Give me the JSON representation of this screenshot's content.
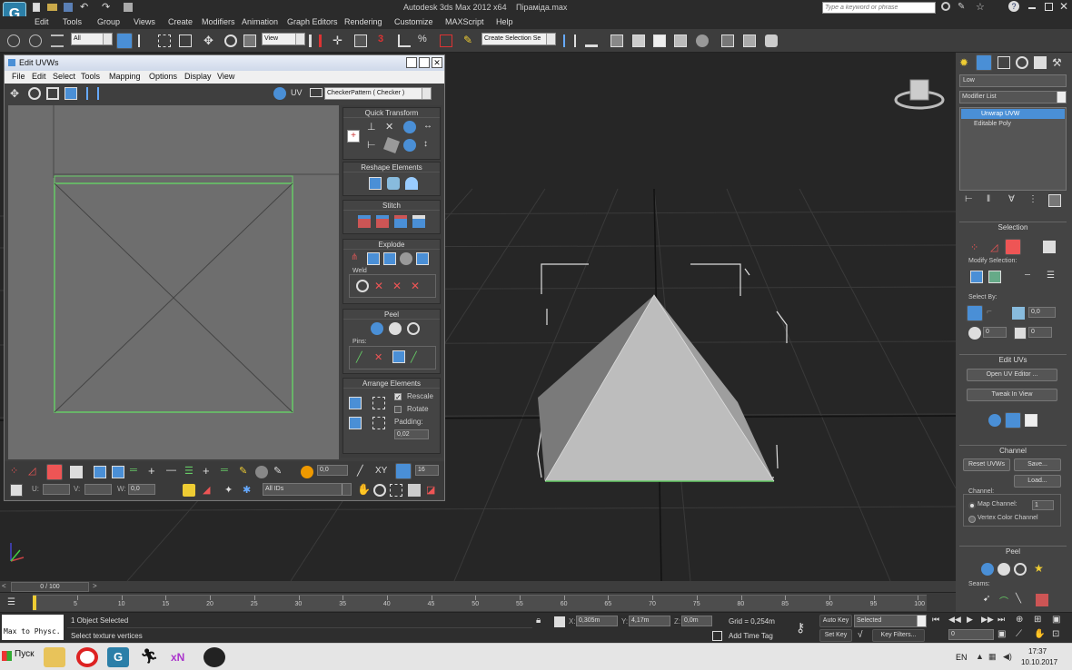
{
  "app": {
    "title": "Autodesk 3ds Max  2012 x64",
    "file": "Піраміда.max",
    "search_placeholder": "Type a keyword or phrase"
  },
  "menu": [
    "Edit",
    "Tools",
    "Group",
    "Views",
    "Create",
    "Modifiers",
    "Animation",
    "Graph Editors",
    "Rendering",
    "Customize",
    "MAXScript",
    "Help"
  ],
  "main_toolbar": {
    "selection_filter": "All",
    "ref_coord": "View",
    "named_selection": "Create Selection Se"
  },
  "uvw_window": {
    "title": "Edit UVWs",
    "menu": [
      "File",
      "Edit",
      "Select",
      "Tools",
      "Mapping",
      "Options",
      "Display",
      "View"
    ],
    "uv_label": "UV",
    "checker": "CheckerPattern  ( Checker )",
    "sections": {
      "quick_transform": "Quick Transform",
      "reshape": "Reshape Elements",
      "stitch": "Stitch",
      "explode": "Explode",
      "weld": "Weld",
      "peel": "Peel",
      "pins": "Pins:",
      "arrange": "Arrange Elements",
      "rescale": "Rescale",
      "rotate": "Rotate",
      "padding_label": "Padding:",
      "padding_value": "0,02"
    },
    "bottom": {
      "soft_value": "0,0",
      "xy": "XY",
      "grid_value": "16",
      "u_label": "U:",
      "v_label": "V:",
      "w_label": "W:",
      "w_value": "0,0",
      "ids": "All IDs"
    }
  },
  "command_panel": {
    "object_name": "Low",
    "modifier_list": "Modifier List",
    "stack": [
      "Unwrap UVW",
      "Editable Poly"
    ],
    "selection": {
      "header": "Selection",
      "modify_selection": "Modify Selection:",
      "select_by": "Select By:",
      "angle": "0,0",
      "val1": "0",
      "val2": "0"
    },
    "edit_uvs": {
      "header": "Edit UVs",
      "open_editor": "Open UV Editor ...",
      "tweak": "Tweak In View"
    },
    "channel": {
      "header": "Channel",
      "reset": "Reset UVWs",
      "save": "Save...",
      "load": "Load...",
      "channel_label": "Channel:",
      "map_channel": "Map Channel:",
      "map_channel_value": "1",
      "vertex_color": "Vertex Color Channel"
    },
    "peel": {
      "header": "Peel",
      "seams": "Seams:"
    }
  },
  "timeline": {
    "frame": "0 / 100",
    "ticks": [
      "5",
      "10",
      "15",
      "20",
      "25",
      "30",
      "35",
      "40",
      "45",
      "50",
      "55",
      "60",
      "65",
      "70",
      "75",
      "80",
      "85",
      "90",
      "95",
      "100"
    ]
  },
  "status": {
    "maxscript": "Max to Physc.",
    "objects": "1 Object Selected",
    "prompt": "Select texture vertices",
    "x_label": "X:",
    "x": "0,305m",
    "y_label": "Y:",
    "y": "4,17m",
    "z_label": "Z:",
    "z": "0,0m",
    "grid": "Grid = 0,254m",
    "add_time_tag": "Add Time Tag",
    "auto_key": "Auto Key",
    "set_key": "Set Key",
    "key_mode": "Selected",
    "key_filters": "Key Filters...",
    "current_frame": "0"
  },
  "taskbar": {
    "start": "Пуск",
    "lang": "EN",
    "time": "17:37",
    "date": "10.10.2017"
  }
}
